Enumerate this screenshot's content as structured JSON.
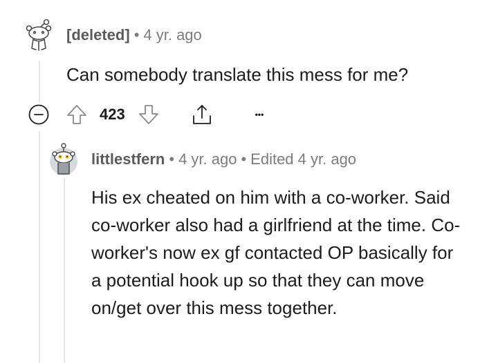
{
  "comment": {
    "author": "[deleted]",
    "separator": "•",
    "age": "4 yr. ago",
    "body": "Can somebody translate this mess for me?",
    "score": "423",
    "more_label": "•••"
  },
  "reply": {
    "author": "littlestfern",
    "separator": "•",
    "age": "4 yr. ago",
    "separator2": "•",
    "edited": "Edited 4 yr. ago",
    "body": "His ex cheated on him with a co-worker. Said co-worker also had a girlfriend at the time. Co-worker's now ex gf contacted OP basically for a potential hook up so that they can move on/get over this mess together."
  },
  "icons": {
    "collapse": "collapse-minus-icon",
    "upvote": "upvote-arrow-icon",
    "downvote": "downvote-arrow-icon",
    "share": "share-icon",
    "more": "more-dots-icon",
    "deleted_avatar": "deleted-user-snoo-icon",
    "reply_avatar": "snoo-avatar-icon"
  },
  "colors": {
    "text": "#1c1c1c",
    "meta": "#7c7c7c",
    "icon": "#878a8c",
    "thread": "#e6e6e6",
    "avatar_bg": "#d7dadc"
  }
}
